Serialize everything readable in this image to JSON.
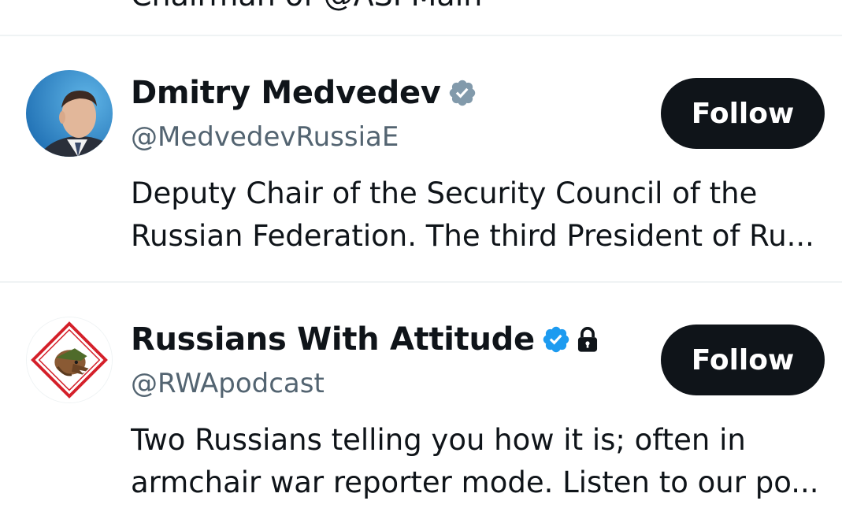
{
  "previous_item": {
    "bio_fragment": "Chairman of @ASPMain"
  },
  "users": [
    {
      "name": "Dmitry Medvedev",
      "handle": "@MedvedevRussiaE",
      "verified": "gray",
      "protected": false,
      "bio_line1": "Deputy Chair of the Security Council of the",
      "bio_line2": "Russian Federation. The third President of Ru...",
      "follow_label": "Follow",
      "badge_color": "#829aab"
    },
    {
      "name": "Russians With Attitude",
      "handle": "@RWApodcast",
      "verified": "blue",
      "protected": true,
      "bio_line1": "Two Russians telling you how it is; often in",
      "bio_line2": "armchair war reporter mode. Listen to our po...",
      "follow_label": "Follow",
      "badge_color": "#1d9bf0"
    }
  ],
  "colors": {
    "text": "#0f1419",
    "secondary": "#536471",
    "divider": "#eff3f4",
    "button_bg": "#0f1419",
    "button_text": "#ffffff"
  }
}
